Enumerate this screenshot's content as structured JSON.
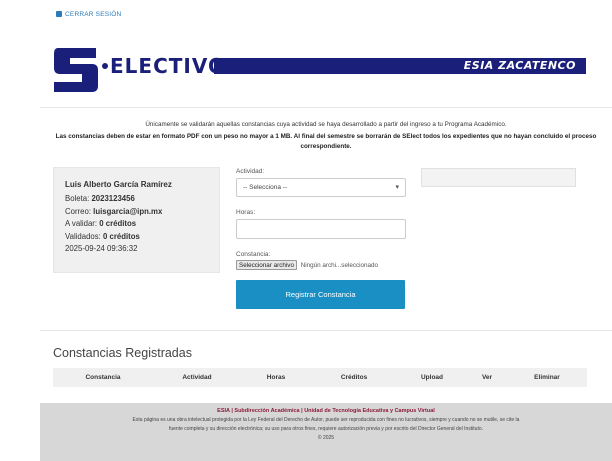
{
  "header": {
    "logout_label": "CERRAR SESIÓN",
    "logo_text": "ELECTIVO",
    "school_label": "ESIA ZACATENCO",
    "brand_color": "#1a1f7a"
  },
  "notice": {
    "line1": "Únicamente se validarán aquellas constancias cuya actividad se haya desarrollado a partir del ingreso a tu Programa Académico.",
    "line2": "Las constancias deben de estar en formato PDF con un peso no mayor a 1 MB. Al final del semestre se borrarán de SElect todos los expedientes que no hayan concluido el proceso correspondiente."
  },
  "profile": {
    "name": "Luis Alberto García Ramírez",
    "boleta_label": "Boleta:",
    "boleta": "2023123456",
    "correo_label": "Correo:",
    "correo": "luisgarcia@ipn.mx",
    "avalidar_label": "A validar:",
    "avalidar": "0 créditos",
    "validados_label": "Validados:",
    "validados": "0 créditos",
    "timestamp": "2025-09-24 09:36:32"
  },
  "form": {
    "actividad_label": "Actividad:",
    "actividad_value": "-- Selecciona --",
    "horas_label": "Horas:",
    "horas_value": "",
    "constancia_label": "Constancia:",
    "file_button": "Seleccionar archivo",
    "file_text": "Ningún archi...seleccionado",
    "submit_label": "Registrar Constancia",
    "accent_color": "#1a8fc4"
  },
  "table": {
    "title": "Constancias Registradas",
    "columns": [
      "Constancia",
      "Actividad",
      "Horas",
      "Créditos",
      "Upload",
      "Ver",
      "Eliminar"
    ]
  },
  "footer": {
    "line1": "ESIA | Subdirección Académica | Unidad de Tecnología Educativa y Campus Virtual",
    "line2": "Esta página es una obra intelectual protegida por la Ley Federal del Derecho de Autor, puede ser reproducida con fines no lucrativos, siempre y cuando no se mutile, se cite la fuente completa y su dirección electrónica; su uso para otros fines, requiere autorización previa y por escrito del Director General del Instituto.",
    "line3": "© 2025"
  }
}
